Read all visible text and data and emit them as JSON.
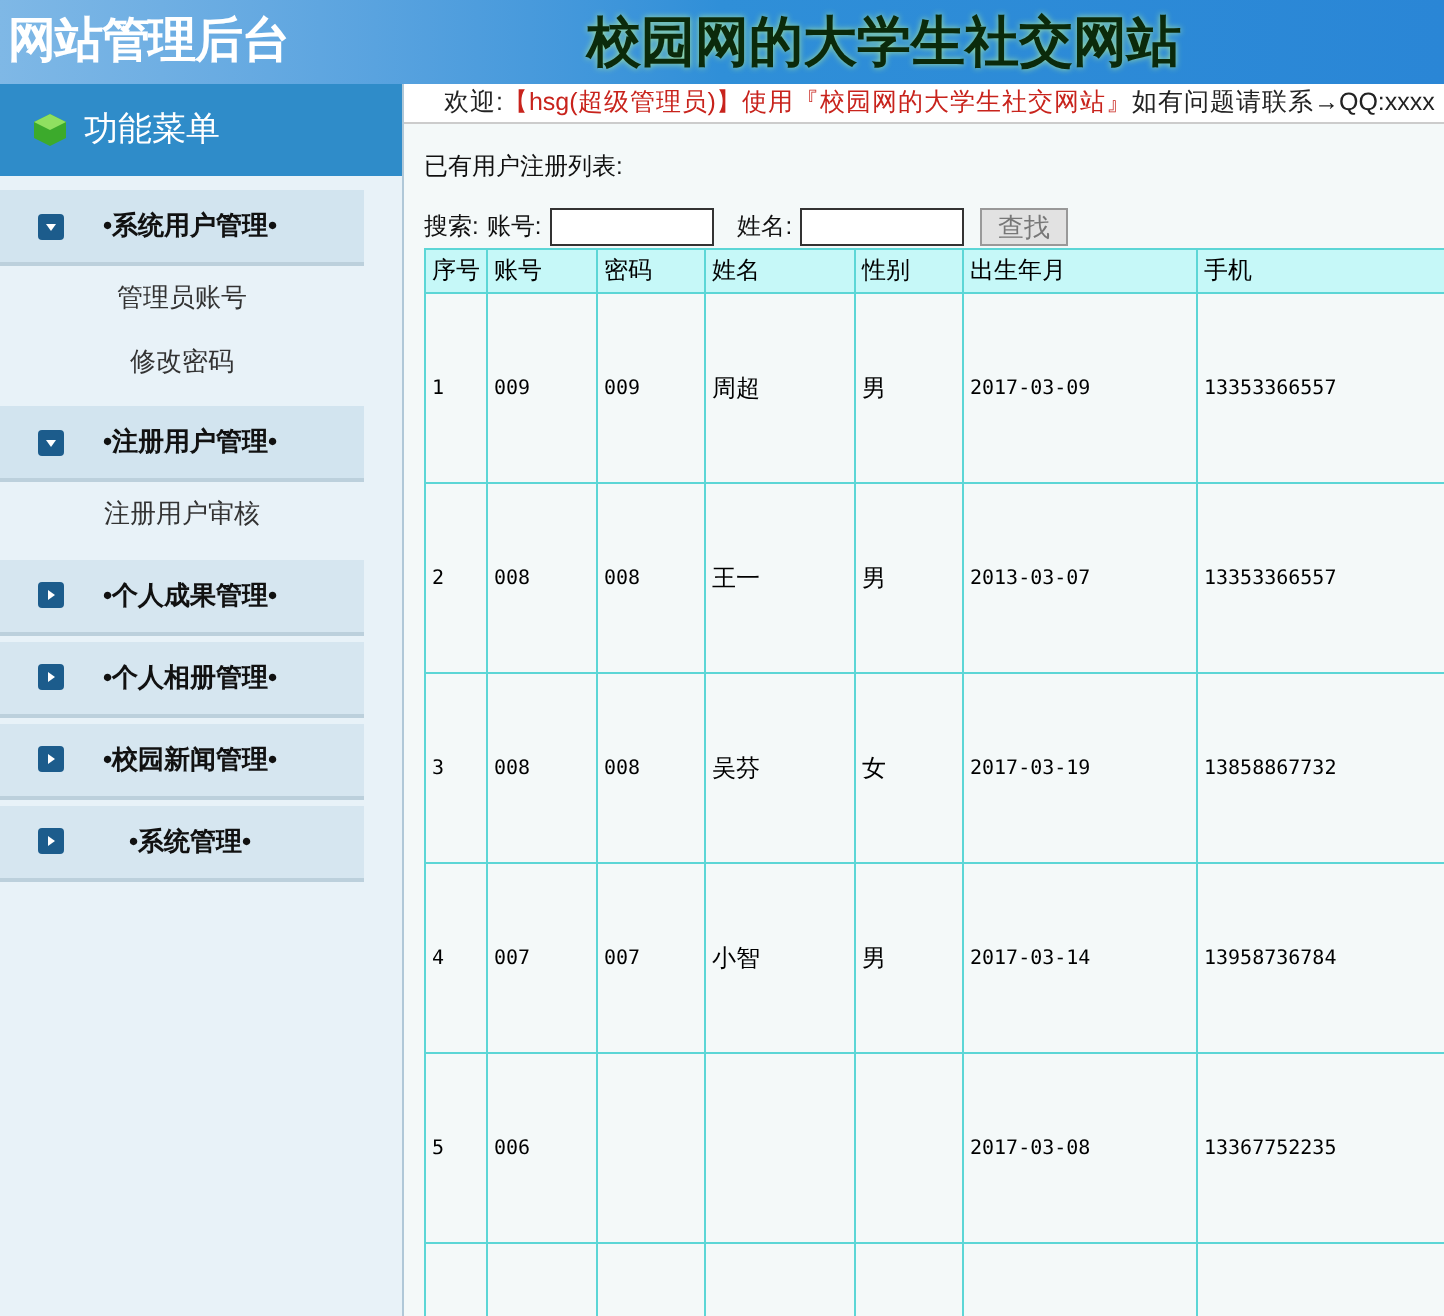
{
  "header": {
    "app_title": "网站管理后台",
    "site_title": "校园网的大学生社交网站"
  },
  "sidebar": {
    "title": "功能菜单",
    "groups": [
      {
        "label": "•系统用户管理•",
        "expanded": true,
        "items": [
          "管理员账号",
          "修改密码"
        ]
      },
      {
        "label": "•注册用户管理•",
        "expanded": true,
        "items": [
          "注册用户审核"
        ]
      },
      {
        "label": "•个人成果管理•",
        "expanded": false
      },
      {
        "label": "•个人相册管理•",
        "expanded": false
      },
      {
        "label": "•校园新闻管理•",
        "expanded": false
      },
      {
        "label": "•系统管理•",
        "expanded": false
      }
    ]
  },
  "welcome": [
    {
      "kind": "plain",
      "text": "欢迎:"
    },
    {
      "kind": "highlight",
      "text": "【hsg(超级管理员)】使用『校园网的大学生社交网站』"
    },
    {
      "kind": "plain",
      "text": "如有问题请联系→QQ:xxxx"
    }
  ],
  "list_title": "已有用户注册列表:",
  "search": {
    "label": "搜索:",
    "account_label": "账号:",
    "name_label": "姓名:",
    "button": "查找"
  },
  "table": {
    "columns": [
      "序号",
      "账号",
      "密码",
      "姓名",
      "性别",
      "出生年月",
      "手机"
    ],
    "rows": [
      [
        "1",
        "009",
        "009",
        "周超",
        "男",
        "2017-03-09",
        "13353366557"
      ],
      [
        "2",
        "008",
        "008",
        "王一",
        "男",
        "2013-03-07",
        "13353366557"
      ],
      [
        "3",
        "008",
        "008",
        "吴芬",
        "女",
        "2017-03-19",
        "13858867732"
      ],
      [
        "4",
        "007",
        "007",
        "小智",
        "男",
        "2017-03-14",
        "13958736784"
      ],
      [
        "5",
        "006",
        null,
        null,
        null,
        "2017-03-08",
        "13367752235"
      ]
    ]
  }
}
